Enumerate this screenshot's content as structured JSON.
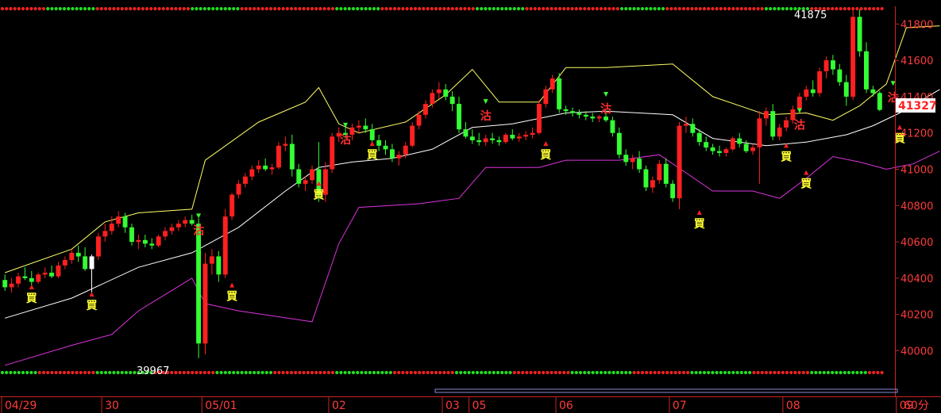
{
  "chart_data": {
    "type": "candlestick",
    "period_label": "60分",
    "y_ticks": [
      40000,
      40200,
      40400,
      40600,
      40800,
      41000,
      41200,
      41400,
      41600,
      41800
    ],
    "ylim": [
      39880,
      41880
    ],
    "last_price": "41327",
    "peak_label": "41875",
    "trough_label": "39967",
    "x_ticks": [
      {
        "label": "04/29",
        "bar": 0
      },
      {
        "label": "30",
        "bar": 15
      },
      {
        "label": "05/01",
        "bar": 30
      },
      {
        "label": "02",
        "bar": 49
      },
      {
        "label": "03",
        "bar": 66
      },
      {
        "label": "05",
        "bar": 70
      },
      {
        "label": "06",
        "bar": 83
      },
      {
        "label": "07",
        "bar": 100
      },
      {
        "label": "08",
        "bar": 117
      },
      {
        "label": "09",
        "bar": 134
      }
    ],
    "signal_labels": {
      "buy": "買",
      "sell": "沽"
    },
    "buy_signals": [
      {
        "bar": 4,
        "price": 40330
      },
      {
        "bar": 13,
        "price": 40290
      },
      {
        "bar": 34,
        "price": 40340
      },
      {
        "bar": 47,
        "price": 40900
      },
      {
        "bar": 55,
        "price": 41120
      },
      {
        "bar": 81,
        "price": 41120
      },
      {
        "bar": 104,
        "price": 40740
      },
      {
        "bar": 117,
        "price": 41110
      },
      {
        "bar": 120,
        "price": 40960
      },
      {
        "bar": 134,
        "price": 41210
      }
    ],
    "sell_signals": [
      {
        "bar": 29,
        "price": 40660
      },
      {
        "bar": 51,
        "price": 41160
      },
      {
        "bar": 72,
        "price": 41290
      },
      {
        "bar": 90,
        "price": 41330
      },
      {
        "bar": 119,
        "price": 41240
      },
      {
        "bar": 133,
        "price": 41390
      }
    ],
    "series": [
      {
        "name": "bb_upper",
        "color": "#ffff66",
        "points": [
          [
            0,
            40430
          ],
          [
            10,
            40560
          ],
          [
            15,
            40710
          ],
          [
            20,
            40760
          ],
          [
            28,
            40780
          ],
          [
            30,
            41050
          ],
          [
            38,
            41260
          ],
          [
            45,
            41370
          ],
          [
            47,
            41450
          ],
          [
            50,
            41250
          ],
          [
            53,
            41200
          ],
          [
            60,
            41260
          ],
          [
            66,
            41410
          ],
          [
            70,
            41550
          ],
          [
            74,
            41370
          ],
          [
            80,
            41370
          ],
          [
            84,
            41560
          ],
          [
            90,
            41560
          ],
          [
            100,
            41580
          ],
          [
            106,
            41400
          ],
          [
            114,
            41300
          ],
          [
            120,
            41310
          ],
          [
            124,
            41270
          ],
          [
            128,
            41350
          ],
          [
            132,
            41470
          ],
          [
            135,
            41780
          ],
          [
            140,
            41790
          ]
        ]
      },
      {
        "name": "bb_middle",
        "color": "#ffffff",
        "points": [
          [
            0,
            40180
          ],
          [
            10,
            40290
          ],
          [
            20,
            40460
          ],
          [
            28,
            40540
          ],
          [
            35,
            40680
          ],
          [
            42,
            40880
          ],
          [
            47,
            41010
          ],
          [
            52,
            41040
          ],
          [
            58,
            41060
          ],
          [
            64,
            41110
          ],
          [
            70,
            41230
          ],
          [
            76,
            41250
          ],
          [
            84,
            41310
          ],
          [
            90,
            41320
          ],
          [
            100,
            41300
          ],
          [
            106,
            41170
          ],
          [
            114,
            41130
          ],
          [
            120,
            41150
          ],
          [
            126,
            41190
          ],
          [
            130,
            41240
          ],
          [
            134,
            41310
          ],
          [
            140,
            41440
          ]
        ]
      },
      {
        "name": "bb_lower",
        "color": "#dd33dd",
        "points": [
          [
            0,
            39920
          ],
          [
            10,
            40030
          ],
          [
            16,
            40090
          ],
          [
            20,
            40220
          ],
          [
            28,
            40400
          ],
          [
            30,
            40260
          ],
          [
            35,
            40220
          ],
          [
            46,
            40160
          ],
          [
            50,
            40590
          ],
          [
            53,
            40790
          ],
          [
            62,
            40810
          ],
          [
            68,
            40840
          ],
          [
            72,
            41010
          ],
          [
            80,
            41010
          ],
          [
            84,
            41050
          ],
          [
            92,
            41050
          ],
          [
            98,
            41080
          ],
          [
            106,
            40880
          ],
          [
            112,
            40880
          ],
          [
            116,
            40840
          ],
          [
            120,
            40950
          ],
          [
            124,
            41070
          ],
          [
            128,
            41040
          ],
          [
            132,
            41000
          ],
          [
            136,
            41030
          ],
          [
            140,
            41100
          ]
        ]
      }
    ],
    "ohlc": [
      [
        40390,
        40420,
        40330,
        40350
      ],
      [
        40350,
        40400,
        40320,
        40370
      ],
      [
        40370,
        40430,
        40350,
        40410
      ],
      [
        40410,
        40460,
        40390,
        40400
      ],
      [
        40400,
        40440,
        40360,
        40380
      ],
      [
        40380,
        40430,
        40370,
        40420
      ],
      [
        40420,
        40460,
        40400,
        40430
      ],
      [
        40430,
        40470,
        40400,
        40410
      ],
      [
        40410,
        40490,
        40400,
        40470
      ],
      [
        40470,
        40520,
        40450,
        40500
      ],
      [
        40500,
        40560,
        40480,
        40540
      ],
      [
        40540,
        40580,
        40490,
        40520
      ],
      [
        40520,
        40570,
        40440,
        40450
      ],
      [
        40450,
        40530,
        40300,
        40520
      ],
      [
        40520,
        40650,
        40500,
        40630
      ],
      [
        40630,
        40700,
        40600,
        40660
      ],
      [
        40660,
        40740,
        40640,
        40700
      ],
      [
        40700,
        40770,
        40680,
        40740
      ],
      [
        40740,
        40760,
        40650,
        40680
      ],
      [
        40680,
        40700,
        40580,
        40600
      ],
      [
        40600,
        40640,
        40560,
        40610
      ],
      [
        40610,
        40640,
        40570,
        40590
      ],
      [
        40590,
        40620,
        40560,
        40580
      ],
      [
        40580,
        40640,
        40570,
        40630
      ],
      [
        40630,
        40680,
        40610,
        40660
      ],
      [
        40660,
        40700,
        40640,
        40680
      ],
      [
        40680,
        40720,
        40660,
        40700
      ],
      [
        40700,
        40740,
        40680,
        40720
      ],
      [
        40720,
        40750,
        40690,
        40700
      ],
      [
        40700,
        40730,
        39960,
        40040
      ],
      [
        40040,
        40540,
        39980,
        40480
      ],
      [
        40480,
        40560,
        40420,
        40520
      ],
      [
        40520,
        40550,
        40380,
        40420
      ],
      [
        40420,
        40780,
        40400,
        40740
      ],
      [
        40740,
        40870,
        40720,
        40860
      ],
      [
        40860,
        40940,
        40840,
        40920
      ],
      [
        40920,
        40980,
        40900,
        40960
      ],
      [
        40960,
        41020,
        40940,
        41000
      ],
      [
        41000,
        41050,
        40980,
        41020
      ],
      [
        41020,
        41060,
        40990,
        41000
      ],
      [
        41000,
        41030,
        40970,
        41010
      ],
      [
        41010,
        41150,
        41000,
        41130
      ],
      [
        41130,
        41180,
        41100,
        41140
      ],
      [
        41140,
        41190,
        40960,
        41000
      ],
      [
        41000,
        41030,
        40900,
        40920
      ],
      [
        40920,
        40960,
        40880,
        40940
      ],
      [
        40940,
        41020,
        40920,
        41000
      ],
      [
        41000,
        41150,
        40820,
        40860
      ],
      [
        40860,
        41040,
        40820,
        41000
      ],
      [
        41000,
        41200,
        40980,
        41180
      ],
      [
        41180,
        41230,
        41150,
        41200
      ],
      [
        41200,
        41240,
        41170,
        41190
      ],
      [
        41190,
        41250,
        41160,
        41230
      ],
      [
        41230,
        41270,
        41200,
        41240
      ],
      [
        41240,
        41280,
        41200,
        41220
      ],
      [
        41220,
        41250,
        41140,
        41160
      ],
      [
        41160,
        41190,
        41100,
        41130
      ],
      [
        41130,
        41160,
        41080,
        41110
      ],
      [
        41110,
        41140,
        41040,
        41060
      ],
      [
        41060,
        41100,
        41020,
        41080
      ],
      [
        41080,
        41150,
        41060,
        41130
      ],
      [
        41130,
        41260,
        41120,
        41240
      ],
      [
        41240,
        41320,
        41220,
        41300
      ],
      [
        41300,
        41380,
        41280,
        41360
      ],
      [
        41360,
        41440,
        41340,
        41420
      ],
      [
        41420,
        41480,
        41390,
        41440
      ],
      [
        41440,
        41470,
        41380,
        41400
      ],
      [
        41400,
        41430,
        41320,
        41360
      ],
      [
        41360,
        41400,
        41200,
        41220
      ],
      [
        41220,
        41260,
        41170,
        41180
      ],
      [
        41180,
        41220,
        41140,
        41160
      ],
      [
        41160,
        41200,
        41130,
        41150
      ],
      [
        41150,
        41190,
        41130,
        41170
      ],
      [
        41170,
        41200,
        41140,
        41160
      ],
      [
        41160,
        41180,
        41130,
        41150
      ],
      [
        41150,
        41200,
        41140,
        41190
      ],
      [
        41190,
        41220,
        41160,
        41170
      ],
      [
        41170,
        41200,
        41150,
        41180
      ],
      [
        41180,
        41210,
        41160,
        41190
      ],
      [
        41190,
        41230,
        41170,
        41200
      ],
      [
        41200,
        41380,
        41190,
        41360
      ],
      [
        41360,
        41460,
        41340,
        41440
      ],
      [
        41440,
        41520,
        41420,
        41500
      ],
      [
        41500,
        41530,
        41310,
        41330
      ],
      [
        41330,
        41350,
        41300,
        41320
      ],
      [
        41320,
        41340,
        41290,
        41310
      ],
      [
        41310,
        41330,
        41280,
        41300
      ],
      [
        41300,
        41320,
        41270,
        41290
      ],
      [
        41290,
        41310,
        41260,
        41280
      ],
      [
        41280,
        41300,
        41260,
        41290
      ],
      [
        41290,
        41310,
        41260,
        41270
      ],
      [
        41270,
        41290,
        41180,
        41200
      ],
      [
        41200,
        41230,
        41060,
        41080
      ],
      [
        41080,
        41110,
        41020,
        41040
      ],
      [
        41040,
        41080,
        41000,
        41060
      ],
      [
        41060,
        41100,
        40980,
        41000
      ],
      [
        41000,
        41020,
        40880,
        40900
      ],
      [
        40900,
        40960,
        40870,
        40940
      ],
      [
        40940,
        41050,
        40920,
        41030
      ],
      [
        41030,
        41060,
        40900,
        40920
      ],
      [
        40920,
        40940,
        40820,
        40840
      ],
      [
        40840,
        41260,
        40780,
        41240
      ],
      [
        41240,
        41290,
        41200,
        41250
      ],
      [
        41250,
        41280,
        41180,
        41200
      ],
      [
        41200,
        41220,
        41130,
        41150
      ],
      [
        41150,
        41180,
        41100,
        41120
      ],
      [
        41120,
        41140,
        41080,
        41100
      ],
      [
        41100,
        41130,
        41070,
        41090
      ],
      [
        41090,
        41120,
        41070,
        41110
      ],
      [
        41110,
        41180,
        41100,
        41170
      ],
      [
        41170,
        41200,
        41120,
        41140
      ],
      [
        41140,
        41160,
        41090,
        41100
      ],
      [
        41100,
        41140,
        41080,
        41120
      ],
      [
        41120,
        41320,
        40920,
        41280
      ],
      [
        41280,
        41340,
        41240,
        41320
      ],
      [
        41320,
        41360,
        41160,
        41180
      ],
      [
        41180,
        41250,
        41160,
        41230
      ],
      [
        41230,
        41290,
        41210,
        41270
      ],
      [
        41270,
        41350,
        41250,
        41330
      ],
      [
        41330,
        41420,
        41310,
        41400
      ],
      [
        41400,
        41460,
        41380,
        41440
      ],
      [
        41440,
        41490,
        41400,
        41420
      ],
      [
        41420,
        41560,
        41400,
        41540
      ],
      [
        41540,
        41620,
        41500,
        41600
      ],
      [
        41600,
        41630,
        41520,
        41550
      ],
      [
        41550,
        41580,
        41460,
        41480
      ],
      [
        41480,
        41520,
        41350,
        41400
      ],
      [
        41400,
        41880,
        41380,
        41840
      ],
      [
        41840,
        41880,
        41620,
        41650
      ],
      [
        41650,
        41700,
        41420,
        41440
      ],
      [
        41440,
        41460,
        41400,
        41420
      ],
      [
        41420,
        41430,
        41320,
        41327
      ]
    ],
    "up_color": "#ff2020",
    "down_color": "#33ff33",
    "highlight_bars": [
      13
    ]
  }
}
